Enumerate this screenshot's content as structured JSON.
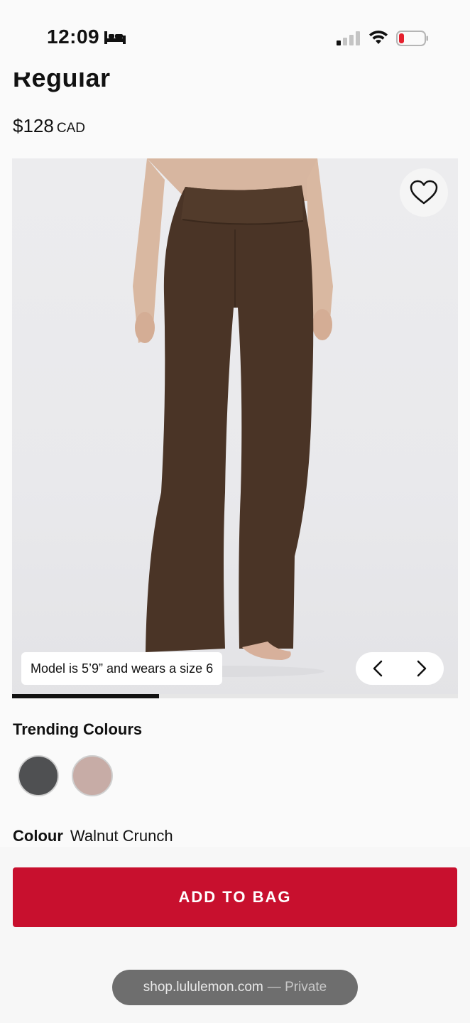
{
  "status_bar": {
    "time": "12:09",
    "icons": [
      "bed-icon",
      "signal-icon",
      "wifi-icon",
      "battery-low-icon"
    ]
  },
  "product": {
    "title": "Regular",
    "price": "$128",
    "currency": "CAD"
  },
  "carousel": {
    "model_caption": "Model is 5’9” and wears a size 6",
    "progress_fraction": 0.33,
    "icons": [
      "heart-icon",
      "chevron-left-icon",
      "chevron-right-icon"
    ]
  },
  "colours": {
    "heading": "Trending Colours",
    "swatches": [
      {
        "name": "dark-grey",
        "color": "#4f5052"
      },
      {
        "name": "dusty-rose",
        "color": "#c7aca6"
      }
    ],
    "selected_label": "Colour",
    "selected_value": "Walnut Crunch"
  },
  "actions": {
    "add_to_bag": "ADD TO BAG"
  },
  "browser": {
    "url": "shop.lululemon.com",
    "separator": "—",
    "mode": "Private"
  },
  "colors": {
    "brand_red": "#c8102e",
    "pant_brown": "#4a3426"
  }
}
